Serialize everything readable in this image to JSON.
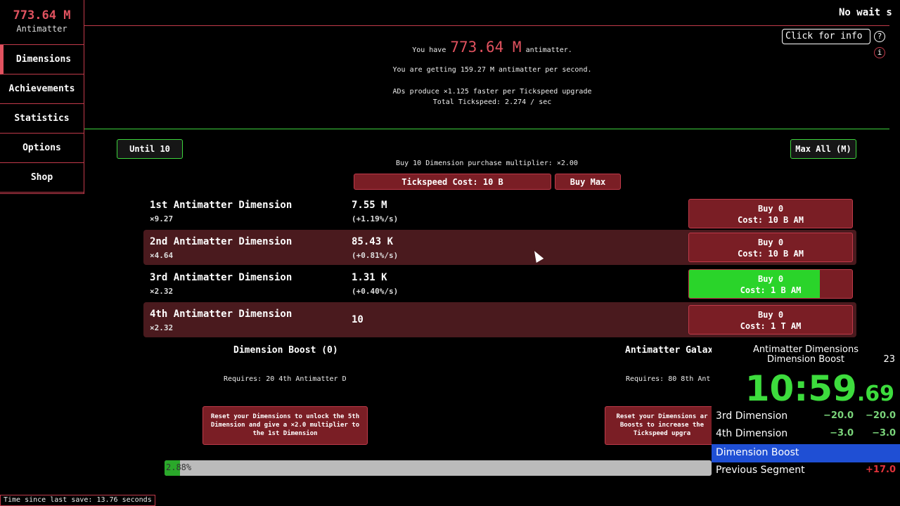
{
  "sidebar": {
    "resource_amount": "773.64 M",
    "resource_label": "Antimatter",
    "items": [
      {
        "label": "Dimensions"
      },
      {
        "label": "Achievements"
      },
      {
        "label": "Statistics"
      },
      {
        "label": "Options"
      },
      {
        "label": "Shop"
      }
    ]
  },
  "header": {
    "news": "No wait s",
    "info_button": "Click for info",
    "help_icon": "?",
    "info_icon": "i",
    "have_prefix": "You have",
    "have_amount": "773.64 M",
    "have_suffix": "antimatter.",
    "per_second": "You are getting 159.27 M antimatter per second.",
    "tickspeed_info": "ADs produce ×1.125 faster per Tickspeed upgrade",
    "total_tickspeed": "Total Tickspeed: 2.274 / sec"
  },
  "controls": {
    "until10": "Until 10",
    "max_all": "Max All (M)",
    "purchase_multiplier": "Buy 10 Dimension purchase multiplier: ×2.00",
    "tickspeed_cost": "Tickspeed Cost: 10 B",
    "buy_max": "Buy Max"
  },
  "dimensions": [
    {
      "name": "1st Antimatter Dimension",
      "mult": "×9.27",
      "amount": "7.55 M",
      "rate": "(+1.19%/s)",
      "buy": "Buy 0",
      "cost": "Cost: 10 B AM",
      "progress": 0
    },
    {
      "name": "2nd Antimatter Dimension",
      "mult": "×4.64",
      "amount": "85.43 K",
      "rate": "(+0.81%/s)",
      "buy": "Buy 0",
      "cost": "Cost: 10 B AM",
      "progress": 0
    },
    {
      "name": "3rd Antimatter Dimension",
      "mult": "×2.32",
      "amount": "1.31 K",
      "rate": "(+0.40%/s)",
      "buy": "Buy 0",
      "cost": "Cost: 1 B AM",
      "progress": 0.8
    },
    {
      "name": "4th Antimatter Dimension",
      "mult": "×2.32",
      "amount": "10",
      "rate": "",
      "buy": "Buy 0",
      "cost": "Cost: 1 T AM",
      "progress": 0
    }
  ],
  "boost": {
    "title": "Dimension Boost (0)",
    "requires": "Requires: 20 4th Antimatter D",
    "button": "Reset your Dimensions to unlock the 5th Dimension and give a ×2.0 multiplier to the 1st Dimension"
  },
  "galaxy": {
    "title": "Antimatter Galax",
    "requires": "Requires: 80 8th Ant",
    "button": "Reset your Dimensions ar Boosts to increase the Tickspeed upgra"
  },
  "progress": {
    "label": "2.88%",
    "value": 0.0288
  },
  "save_text": "Time since last save: 13.76 seconds",
  "timer": {
    "game": "Antimatter Dimensions",
    "category": "Dimension Boost",
    "attempts": "23",
    "time_main": "10:59",
    "time_ms": ".69",
    "segments": [
      {
        "name": "3rd Dimension",
        "delta": "−20.0",
        "split": "−20.0"
      },
      {
        "name": "4th Dimension",
        "delta": "−3.0",
        "split": "−3.0"
      },
      {
        "name": "Dimension Boost",
        "delta": "",
        "split": ""
      }
    ],
    "previous_label": "Previous Segment",
    "previous_value": "+17.0"
  },
  "colors": {
    "accent_red": "#e1525f",
    "border_red": "#c13a4a",
    "button_red": "#7a1e25",
    "accent_green": "#3dd43d",
    "timer_blue": "#1f4fd4"
  }
}
